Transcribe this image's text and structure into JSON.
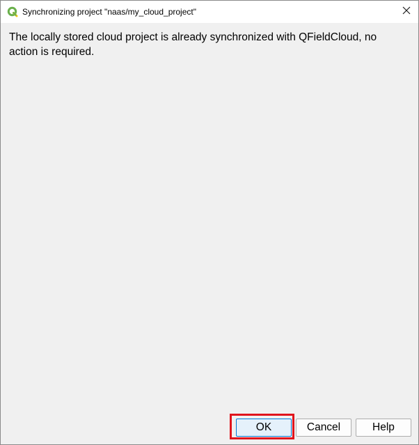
{
  "window": {
    "title": "Synchronizing project \"naas/my_cloud_project\"",
    "app_icon": "qgis-icon",
    "close_icon": "close-icon"
  },
  "dialog": {
    "message": "The locally stored cloud project is already synchronized with QFieldCloud, no action is required."
  },
  "buttons": {
    "ok_label": "OK",
    "cancel_label": "Cancel",
    "help_label": "Help"
  },
  "colors": {
    "dialog_background": "#f0f0f0",
    "titlebar_background": "#ffffff",
    "highlight_border": "#e0141c",
    "default_button_border": "#0078d4",
    "qgis_green": "#6ab04c"
  }
}
